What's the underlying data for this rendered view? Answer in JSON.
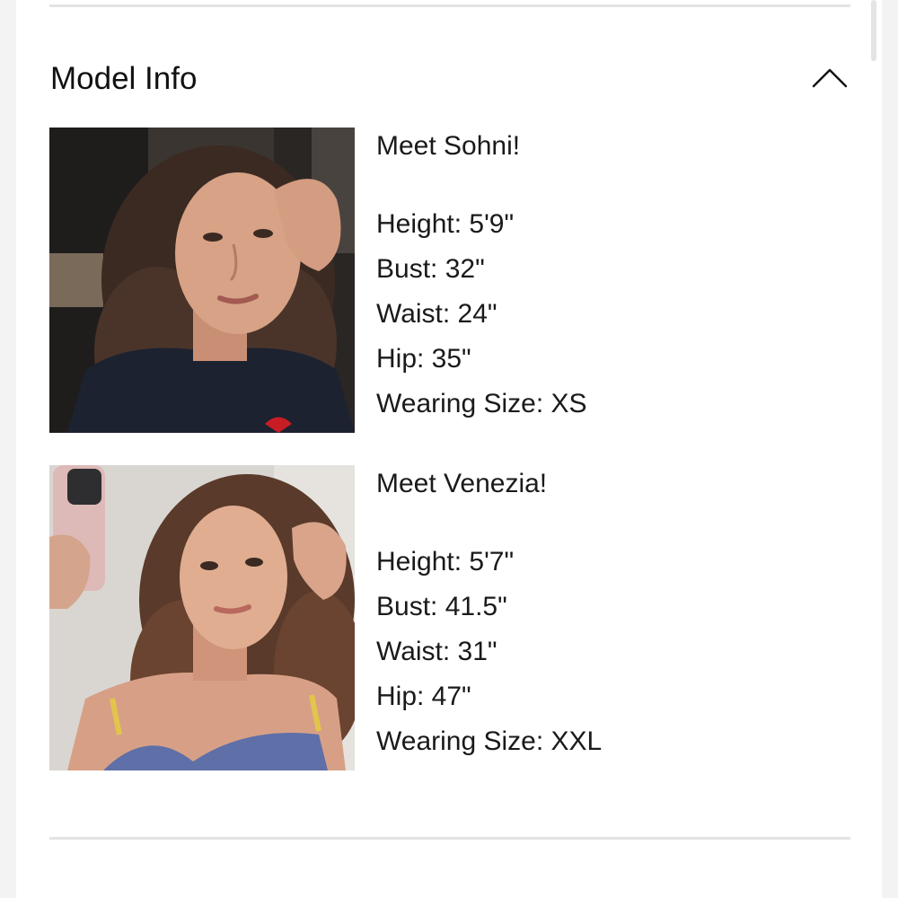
{
  "section": {
    "title": "Model Info",
    "toggle_icon": "chevron-up-icon",
    "expanded": true
  },
  "models": [
    {
      "greeting": "Meet Sohni!",
      "height": "Height: 5'9\"",
      "bust": "Bust: 32\"",
      "waist": "Waist: 24\"",
      "hip": "Hip: 35\"",
      "size": "Wearing Size: XS"
    },
    {
      "greeting": "Meet Venezia!",
      "height": "Height: 5'7\"",
      "bust": "Bust: 41.5\"",
      "waist": "Waist: 31\"",
      "hip": "Hip: 47\"",
      "size": "Wearing Size: XXL"
    }
  ]
}
